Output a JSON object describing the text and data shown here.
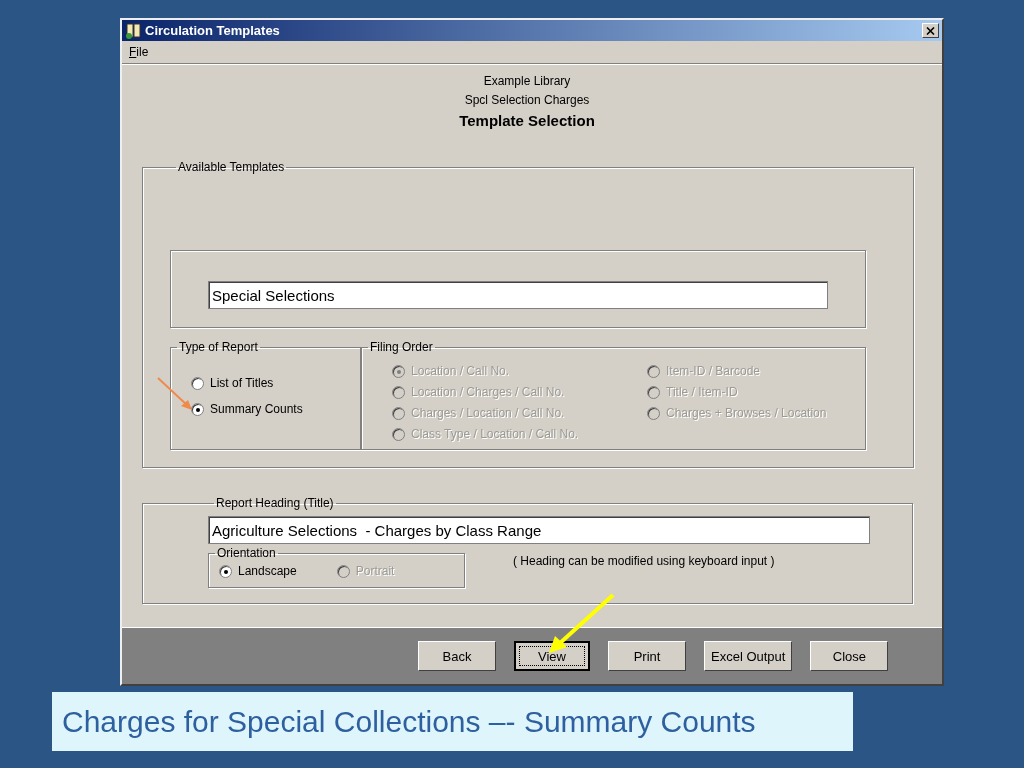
{
  "window": {
    "title": "Circulation Templates"
  },
  "menu": [
    {
      "label": "File"
    }
  ],
  "header": {
    "library": "Example Library",
    "subtitle": "Spcl Selection Charges",
    "title": "Template Selection"
  },
  "available_templates": {
    "label": "Available Templates",
    "template": "Special Selections"
  },
  "type_of_report": {
    "label": "Type of Report",
    "options": [
      {
        "label": "List of Titles",
        "selected": false
      },
      {
        "label": "Summary Counts",
        "selected": true
      }
    ]
  },
  "filing_order": {
    "label": "Filing Order",
    "columns": [
      [
        {
          "label": "Location / Call No.",
          "selected": true,
          "disabled": true
        },
        {
          "label": "Location / Charges / Call No.",
          "selected": false,
          "disabled": true
        },
        {
          "label": "Charges / Location / Call No.",
          "selected": false,
          "disabled": true
        },
        {
          "label": "Class Type / Location / Call No.",
          "selected": false,
          "disabled": true
        }
      ],
      [
        {
          "label": "Item-ID / Barcode",
          "selected": false,
          "disabled": true
        },
        {
          "label": "Title / Item-ID",
          "selected": false,
          "disabled": true
        },
        {
          "label": "Charges + Browses / Location",
          "selected": false,
          "disabled": true
        }
      ]
    ]
  },
  "report_heading": {
    "label": "Report Heading (Title)",
    "value": "Agriculture Selections  - Charges by Class Range",
    "note": "( Heading can be modified using keyboard input )",
    "orientation": {
      "label": "Orientation",
      "options": [
        {
          "label": "Landscape",
          "selected": true,
          "disabled": false
        },
        {
          "label": "Portrait",
          "selected": false,
          "disabled": true
        }
      ]
    }
  },
  "buttons": [
    {
      "label": "Back",
      "selected": false
    },
    {
      "label": "View",
      "selected": true
    },
    {
      "label": "Print",
      "selected": false
    },
    {
      "label": "Excel Output",
      "selected": false
    },
    {
      "label": "Close",
      "selected": false
    }
  ],
  "caption": "Charges for Special Collections –- Summary Counts"
}
